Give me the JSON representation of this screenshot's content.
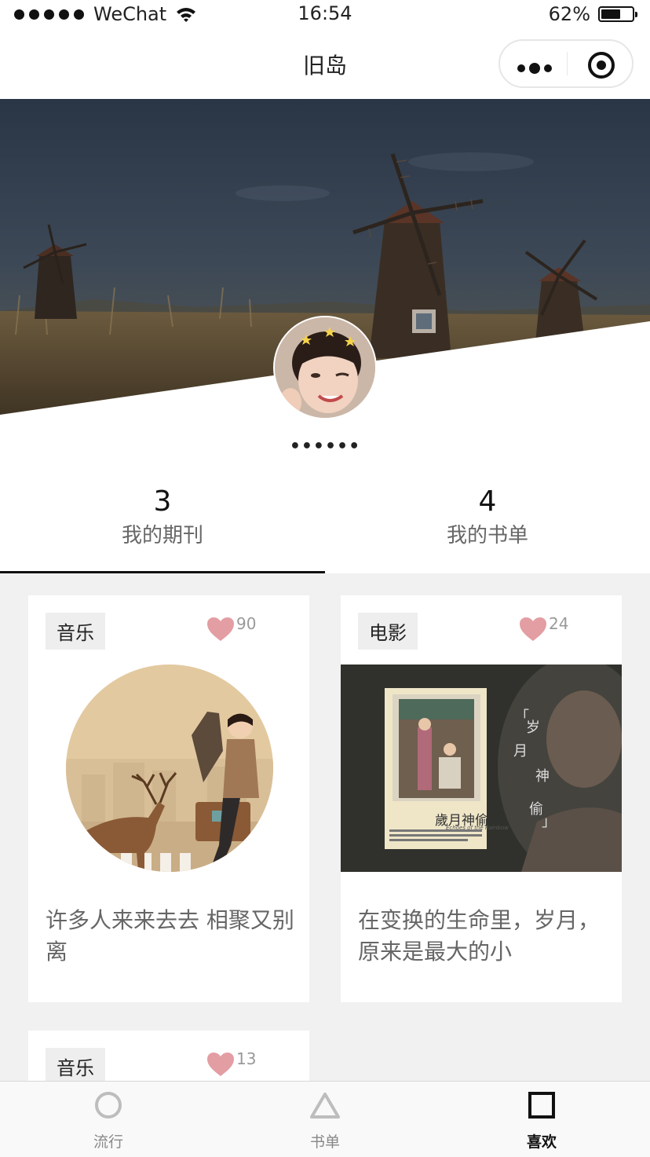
{
  "status_bar": {
    "carrier": "WeChat",
    "time": "16:54",
    "battery": "62%",
    "battery_level": 0.62
  },
  "nav": {
    "title": "旧岛"
  },
  "profile": {
    "nickname": "••••••"
  },
  "stats": [
    {
      "count": "3",
      "label": "我的期刊"
    },
    {
      "count": "4",
      "label": "我的书单"
    }
  ],
  "cards": [
    {
      "tag": "音乐",
      "likes": "90",
      "text": "许多人来来去去 相聚又别离"
    },
    {
      "tag": "电影",
      "likes": "24",
      "text": "在变换的生命里，岁月，原来是最大的小"
    },
    {
      "tag": "音乐",
      "likes": "13",
      "text": ""
    }
  ],
  "movie_poster": {
    "title": "歲月神偷",
    "subtitle": "Echoes of the Rainbow",
    "quote": [
      "「",
      "岁",
      "月",
      "神",
      "偷",
      "」"
    ]
  },
  "tabbar": [
    {
      "label": "流行",
      "icon": "circle-icon",
      "active": false
    },
    {
      "label": "书单",
      "icon": "triangle-icon",
      "active": false
    },
    {
      "label": "喜欢",
      "icon": "square-icon",
      "active": true
    }
  ],
  "colors": {
    "heart": "#e39ea3",
    "tag_bg": "#eeeeee",
    "content_bg": "#f1f1f1"
  }
}
